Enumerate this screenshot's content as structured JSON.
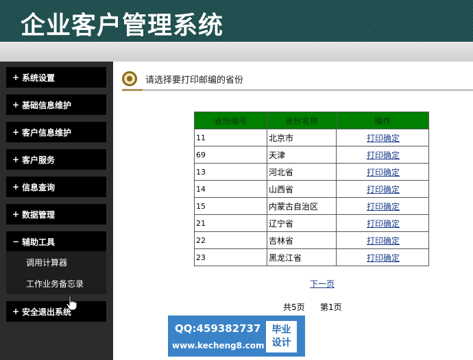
{
  "header": {
    "title": "企业客户管理系统"
  },
  "sidebar": {
    "menu": [
      {
        "sign": "+",
        "label": "系统设置"
      },
      {
        "sign": "+",
        "label": "基础信息维护"
      },
      {
        "sign": "+",
        "label": "客户信息维护"
      },
      {
        "sign": "+",
        "label": "客户服务"
      },
      {
        "sign": "+",
        "label": "信息查询"
      },
      {
        "sign": "+",
        "label": "数据管理"
      },
      {
        "sign": "−",
        "label": "辅助工具"
      },
      {
        "sign": "+",
        "label": "安全退出系统"
      }
    ],
    "submenu": [
      {
        "label": "调用计算器"
      },
      {
        "label": "工作业务备忘录"
      }
    ]
  },
  "main": {
    "title": "请选择要打印邮编的省份",
    "table": {
      "columns": [
        "省份编号",
        "省份名称",
        "操作"
      ],
      "rows": [
        {
          "code": "11",
          "name": "北京市",
          "action": "打印确定"
        },
        {
          "code": "69",
          "name": "天津",
          "action": "打印确定"
        },
        {
          "code": "13",
          "name": "河北省",
          "action": "打印确定"
        },
        {
          "code": "14",
          "name": "山西省",
          "action": "打印确定"
        },
        {
          "code": "15",
          "name": "内蒙古自治区",
          "action": "打印确定"
        },
        {
          "code": "21",
          "name": "辽宁省",
          "action": "打印确定"
        },
        {
          "code": "22",
          "name": "吉林省",
          "action": "打印确定"
        },
        {
          "code": "23",
          "name": "黑龙江省",
          "action": "打印确定"
        }
      ]
    },
    "pager": {
      "next_label": "下一页",
      "total_label": "共5页",
      "current_label": "第1页"
    }
  },
  "watermark": {
    "qq": "QQ:459382737",
    "url": "www.kecheng8.com",
    "line1": "毕业",
    "line2": "设计"
  },
  "colors": {
    "banner": "#1f4f4f",
    "table_header": "#008000",
    "link": "#1a3a8a",
    "badge": "#3b83c8"
  },
  "icons": {
    "title_icon": "ring-icon",
    "pointer": "hand-cursor-icon"
  }
}
